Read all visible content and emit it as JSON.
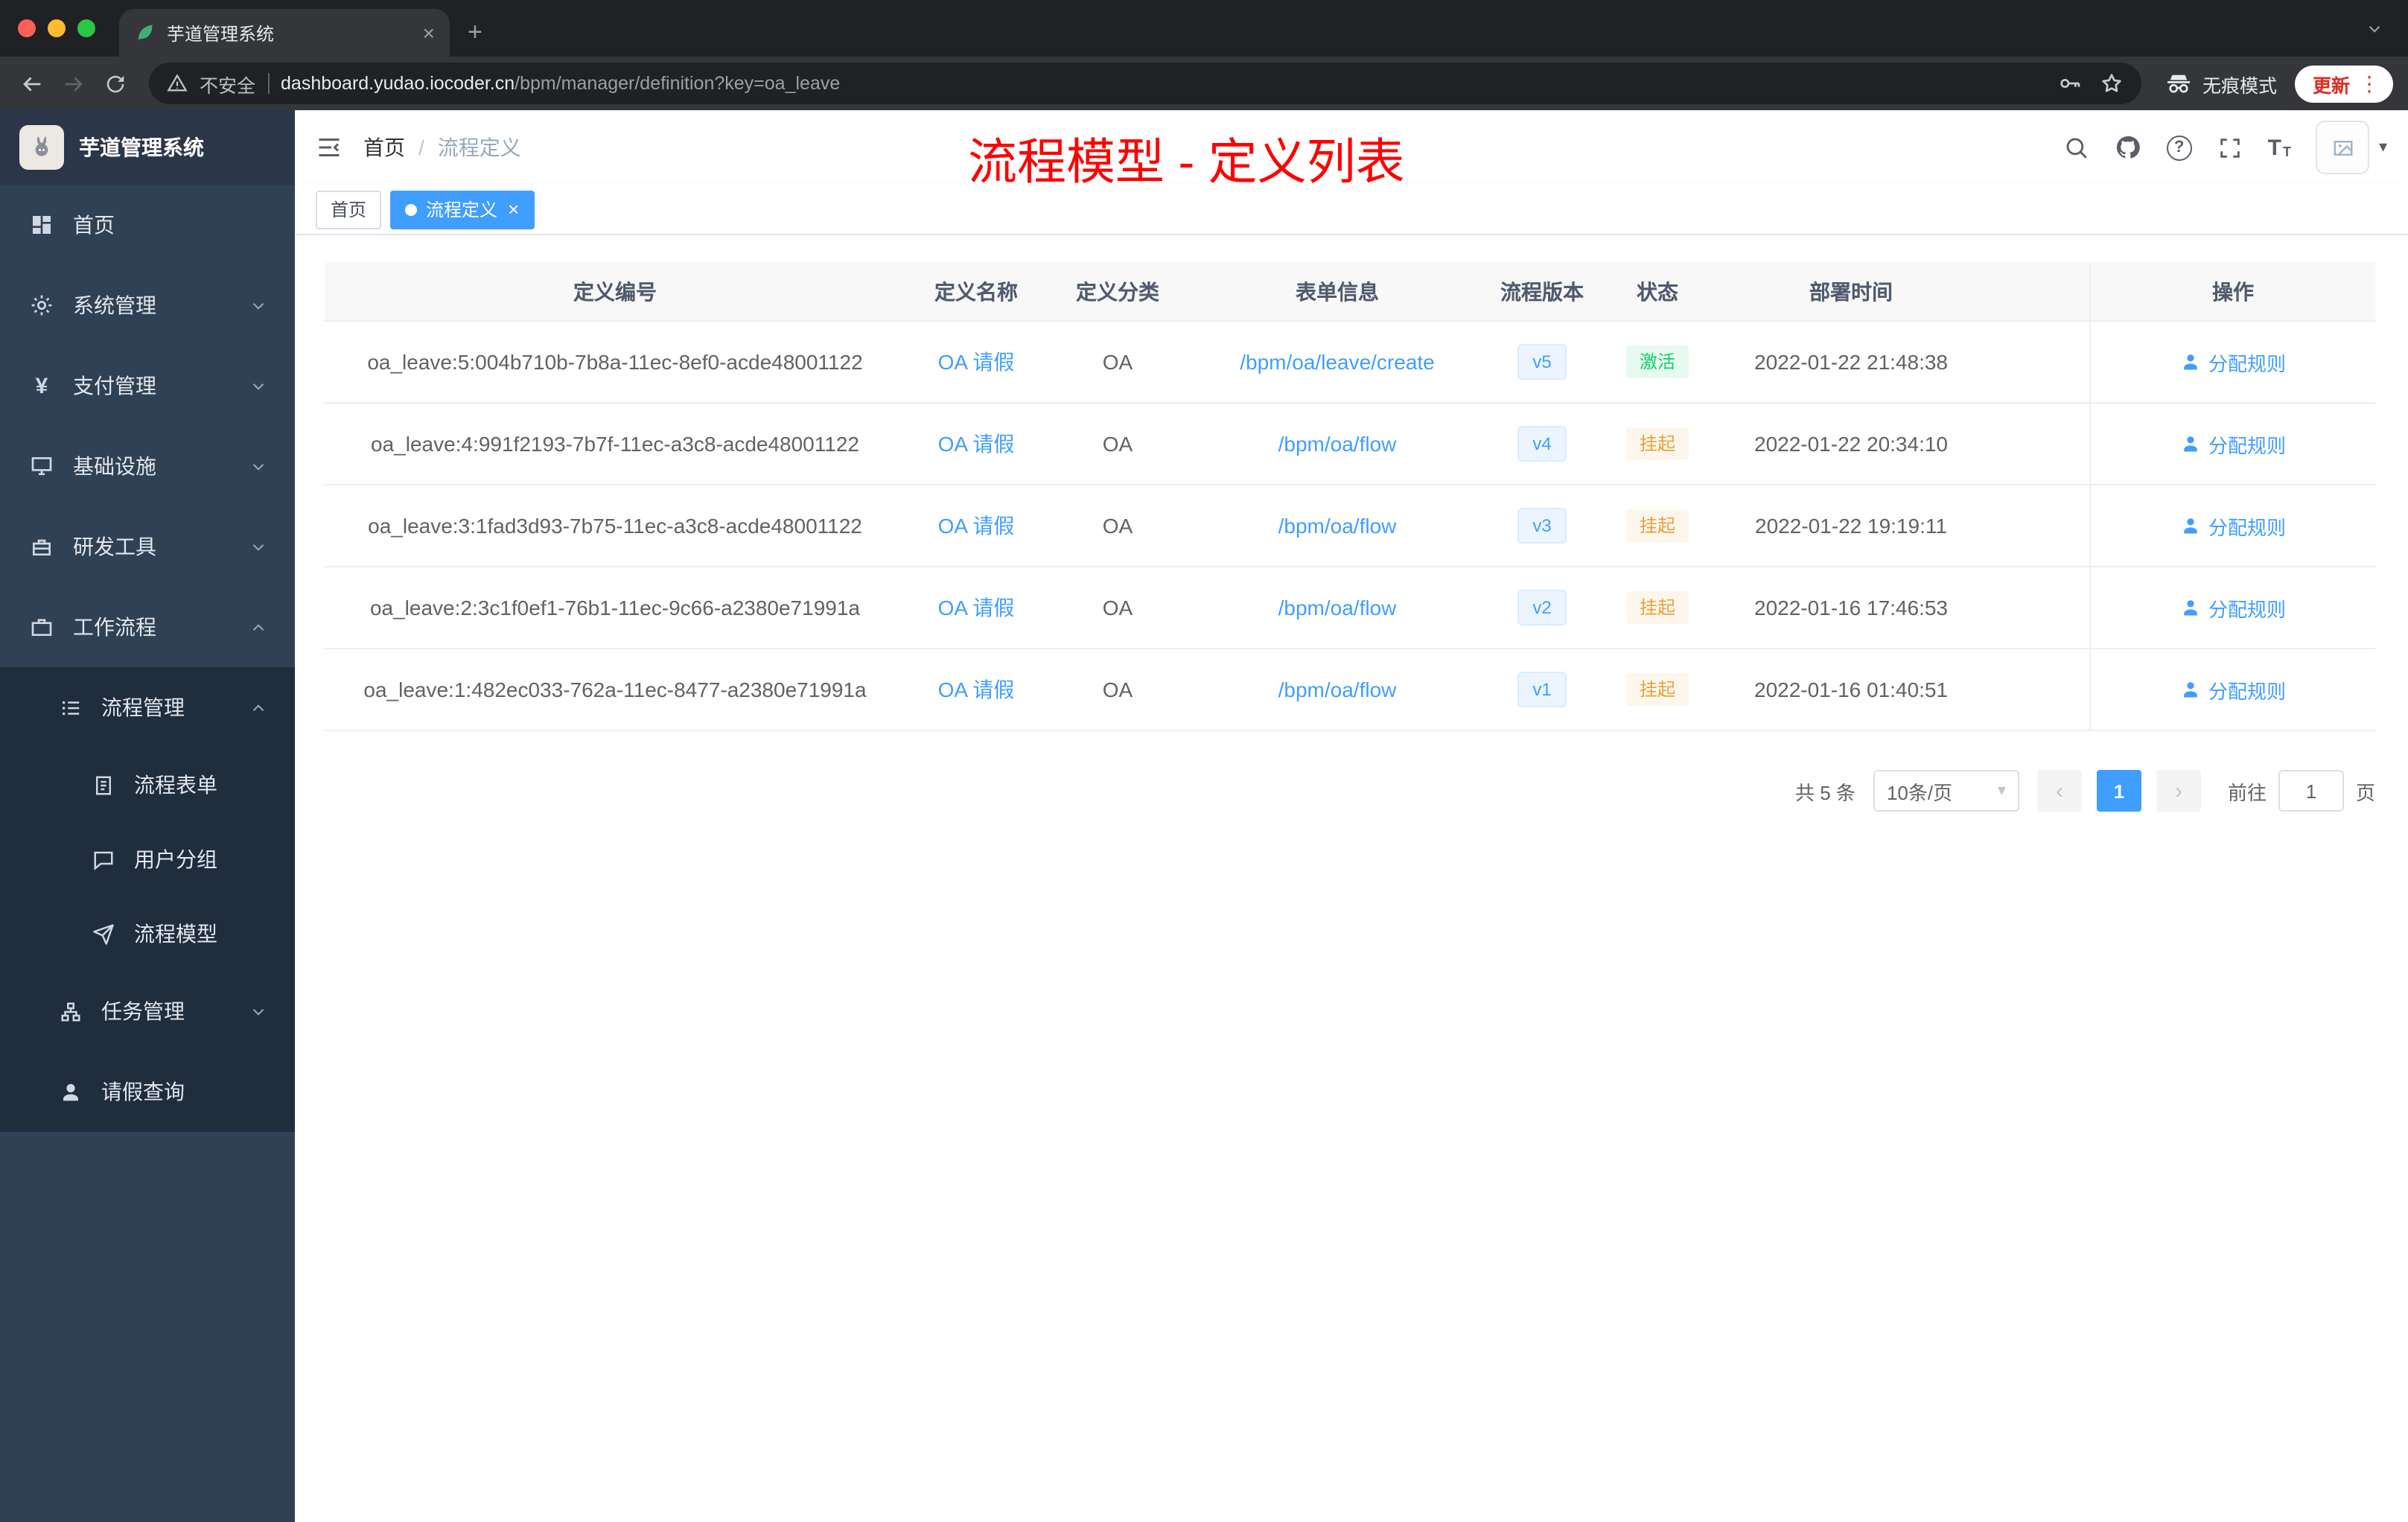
{
  "browser": {
    "tab_title": "芋道管理系统",
    "security_label": "不安全",
    "url_domain": "dashboard.yudao.iocoder.cn",
    "url_path": "/bpm/manager/definition?key=oa_leave",
    "incognito_label": "无痕模式",
    "update_label": "更新"
  },
  "sidebar": {
    "logo_title": "芋道管理系统",
    "menu": [
      {
        "label": "首页"
      },
      {
        "label": "系统管理"
      },
      {
        "label": "支付管理"
      },
      {
        "label": "基础设施"
      },
      {
        "label": "研发工具"
      },
      {
        "label": "工作流程"
      }
    ],
    "submenu": {
      "process_mgmt": "流程管理",
      "process_form": "流程表单",
      "user_group": "用户分组",
      "process_model": "流程模型",
      "task_mgmt": "任务管理",
      "leave_query": "请假查询"
    }
  },
  "header": {
    "breadcrumb_home": "首页",
    "breadcrumb_sep": "/",
    "breadcrumb_current": "流程定义",
    "annotation": "流程模型 - 定义列表"
  },
  "tags": {
    "home": "首页",
    "active": "流程定义"
  },
  "table": {
    "columns": [
      "定义编号",
      "定义名称",
      "定义分类",
      "表单信息",
      "流程版本",
      "状态",
      "部署时间",
      "操作"
    ],
    "rows": [
      {
        "id": "oa_leave:5:004b710b-7b8a-11ec-8ef0-acde48001122",
        "name": "OA 请假",
        "category": "OA",
        "form": "/bpm/oa/leave/create",
        "version": "v5",
        "status": "激活",
        "deploy_time": "2022-01-22 21:48:38",
        "action": "分配规则"
      },
      {
        "id": "oa_leave:4:991f2193-7b7f-11ec-a3c8-acde48001122",
        "name": "OA 请假",
        "category": "OA",
        "form": "/bpm/oa/flow",
        "version": "v4",
        "status": "挂起",
        "deploy_time": "2022-01-22 20:34:10",
        "action": "分配规则"
      },
      {
        "id": "oa_leave:3:1fad3d93-7b75-11ec-a3c8-acde48001122",
        "name": "OA 请假",
        "category": "OA",
        "form": "/bpm/oa/flow",
        "version": "v3",
        "status": "挂起",
        "deploy_time": "2022-01-22 19:19:11",
        "action": "分配规则"
      },
      {
        "id": "oa_leave:2:3c1f0ef1-76b1-11ec-9c66-a2380e71991a",
        "name": "OA 请假",
        "category": "OA",
        "form": "/bpm/oa/flow",
        "version": "v2",
        "status": "挂起",
        "deploy_time": "2022-01-16 17:46:53",
        "action": "分配规则"
      },
      {
        "id": "oa_leave:1:482ec033-762a-11ec-8477-a2380e71991a",
        "name": "OA 请假",
        "category": "OA",
        "form": "/bpm/oa/flow",
        "version": "v1",
        "status": "挂起",
        "deploy_time": "2022-01-16 01:40:51",
        "action": "分配规则"
      }
    ]
  },
  "pagination": {
    "total": "共 5 条",
    "page_size": "10条/页",
    "current_page": "1",
    "goto_label": "前往",
    "goto_value": "1",
    "unit_label": "页"
  },
  "icons": {
    "close": "×",
    "plus": "+",
    "kebab": "⋮",
    "caret_down": "▾",
    "chevron_left": "‹",
    "chevron_right": "›",
    "yen": "¥",
    "question": "?",
    "letter_T": "T"
  },
  "colors": {
    "accent": "#409eff",
    "success": "#13ce66",
    "warning": "#e6a23c",
    "annotation_red": "#ff0000",
    "sidebar_bg": "#304156",
    "submenu_bg": "#1f2d3d",
    "version_tag_bg": "#ecf5ff",
    "status_active_bg": "#e7faf0",
    "status_suspend_bg": "#fdf6ec"
  }
}
